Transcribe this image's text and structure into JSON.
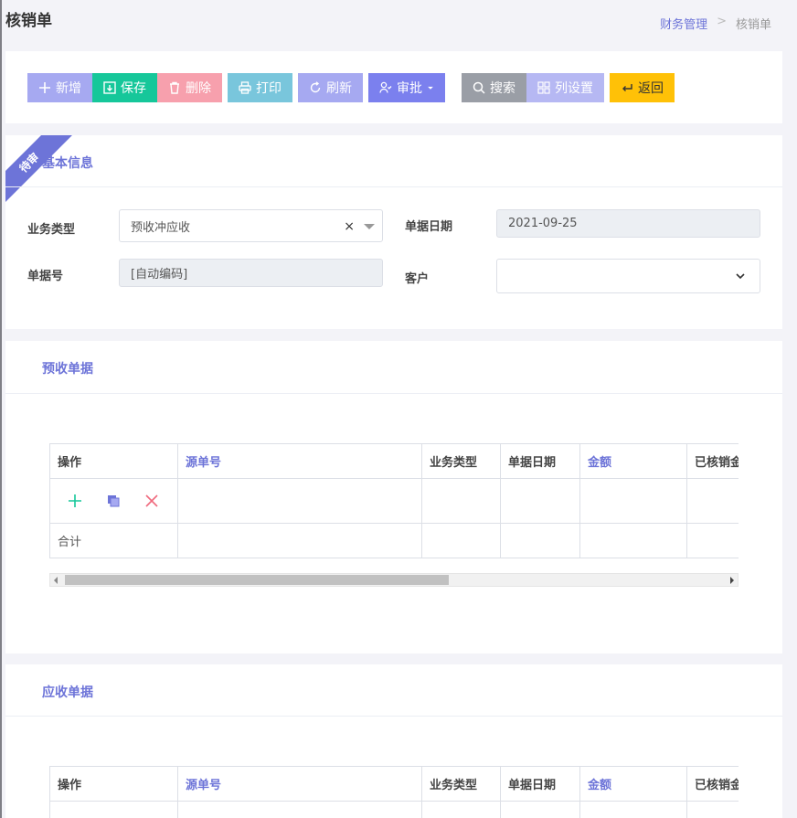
{
  "page": {
    "title": "核销单",
    "breadcrumb": {
      "parent": "财务管理",
      "separator": ">",
      "current": "核销单"
    }
  },
  "toolbar": {
    "add": "新增",
    "save": "保存",
    "delete": "删除",
    "print": "打印",
    "refresh": "刷新",
    "approve": "审批",
    "search": "搜索",
    "columns": "列设置",
    "back": "返回"
  },
  "basic_info": {
    "title": "基本信息",
    "ribbon": "待审",
    "business_type_label": "业务类型",
    "business_type_value": "预收冲应收",
    "clear_symbol": "×",
    "doc_date_label": "单据日期",
    "doc_date_value": "2021-09-25",
    "doc_no_label": "单据号",
    "doc_no_value": "[自动编码]",
    "customer_label": "客户",
    "customer_value": ""
  },
  "prepaid_section": {
    "title": "预收单据",
    "columns": [
      "操作",
      "源单号",
      "业务类型",
      "单据日期",
      "金额",
      "已核销金额"
    ],
    "total_label": "合计"
  },
  "receivable_section": {
    "title": "应收单据",
    "columns": [
      "操作",
      "源单号",
      "业务类型",
      "单据日期",
      "金额",
      "已核销金额"
    ]
  },
  "colors": {
    "accent": "#6d74d8",
    "add": "#a6a9f1",
    "save": "#16c79a",
    "delete": "#f7a0ad",
    "print": "#79c6dc",
    "refresh": "#a6a9f1",
    "approve": "#7b80ee",
    "search": "#9a9ea6",
    "columns": "#b6b8f3",
    "back": "#ffc107"
  }
}
